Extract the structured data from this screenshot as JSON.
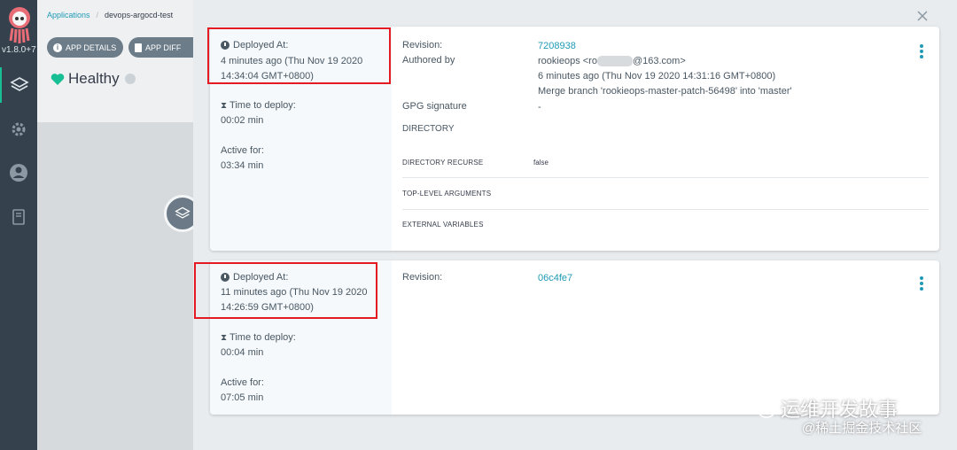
{
  "nav": {
    "version": "v1.8.0+7",
    "items": [
      "applications-icon",
      "settings-icon",
      "user-icon",
      "docs-icon"
    ]
  },
  "app": {
    "breadcrumb": {
      "root": "Applications",
      "separator": "/",
      "current": "devops-argocd-test"
    },
    "buttons": {
      "details": "APP DETAILS",
      "diff": "APP DIFF"
    },
    "health": "Healthy"
  },
  "history": [
    {
      "deployed_label": "Deployed At:",
      "deployed_value_line1": "4 minutes ago (Thu Nov 19 2020",
      "deployed_value_line2": "14:34:04 GMT+0800)",
      "time_label": "Time to deploy:",
      "time_value": "00:02 min",
      "active_label": "Active for:",
      "active_value": "03:34 min",
      "revision_label": "Revision:",
      "revision_value": "7208938",
      "authored_label": "Authored by",
      "author_prefix": "rookieops <ro",
      "author_suffix": "@163.com>",
      "commit_time": "6 minutes ago (Thu Nov 19 2020 14:31:16 GMT+0800)",
      "commit_message": "Merge branch 'rookieops-master-patch-56498' into 'master'",
      "gpg_label": "GPG signature",
      "gpg_value": "-",
      "directory_label": "DIRECTORY",
      "recurse_label": "DIRECTORY RECURSE",
      "recurse_value": "false",
      "toplevel_label": "TOP-LEVEL ARGUMENTS",
      "external_label": "EXTERNAL VARIABLES"
    },
    {
      "deployed_label": "Deployed At:",
      "deployed_value_line1": "11 minutes ago (Thu Nov 19 2020",
      "deployed_value_line2": "14:26:59 GMT+0800)",
      "time_label": "Time to deploy:",
      "time_value": "00:04 min",
      "active_label": "Active for:",
      "active_value": "07:05 min",
      "revision_label": "Revision:",
      "revision_value": "06c4fe7"
    }
  ],
  "watermark": {
    "line1": "运维开发故事",
    "line2": "@稀土掘金技术社区"
  },
  "colors": {
    "accent": "#1f9bb5",
    "highlight": "#e41b23",
    "healthy": "#18be94",
    "nav": "#35414d"
  }
}
